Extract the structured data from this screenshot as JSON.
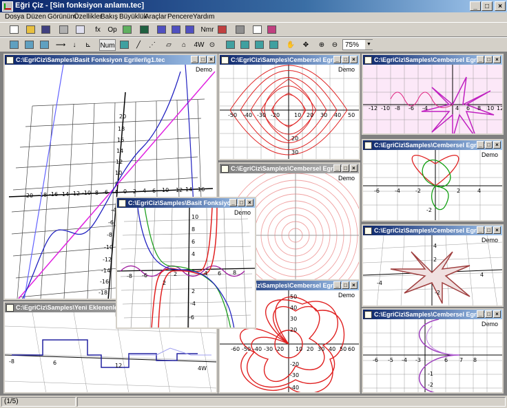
{
  "app_title": "Eğri Çiz - [Sin fonksiyon anlamı.tec]",
  "menu": [
    "Dosya",
    "Düzen",
    "Görünüm",
    "Özellikler",
    "Bakış",
    "Büyüklük",
    "Araçlar",
    "Pencere",
    "Yardım"
  ],
  "toolbar1": {
    "fx_label": "fx",
    "op_label": "Op",
    "nmr_label": "Nmr"
  },
  "toolbar2": {
    "num_label": "Num",
    "fourw_label": "4W",
    "zoom_value": "75%"
  },
  "demo_label": "Demo",
  "windows": [
    {
      "title": "C:\\EgriCiz\\Samples\\Basit Fonksiyon Egrileri\\g1.tec"
    },
    {
      "title": "C:\\EgriCiz\\Samples\\Cembersel Egriler"
    },
    {
      "title": "C:\\EgriCiz\\Samples\\Cembersel Egriler"
    },
    {
      "title": "C:\\EgriCiz\\Samples\\Cembersel Egriler"
    },
    {
      "title": "C:\\EgriCiz\\Samples\\Cembersel Egriler"
    },
    {
      "title": "C:\\EgriCiz\\Samples\\Cembersel Egriler"
    },
    {
      "title": "C:\\EgriCiz\\Samples\\Cembersel Egriler"
    },
    {
      "title": "C:\\EgriCiz\\Samples\\Cembersel Egriler"
    },
    {
      "title": "C:\\EgriCiz\\Samples\\Yeni Eklenenler"
    },
    {
      "title": "C:\\EgriCiz\\Samples\\Basit Fonksiyon..."
    }
  ],
  "status": {
    "page": "(1/5)"
  },
  "colors": {
    "red": "#e02020",
    "blue": "#2020c0",
    "magenta": "#e020e0",
    "green": "#10a010",
    "purple": "#a040c0",
    "brown": "#a04040"
  }
}
